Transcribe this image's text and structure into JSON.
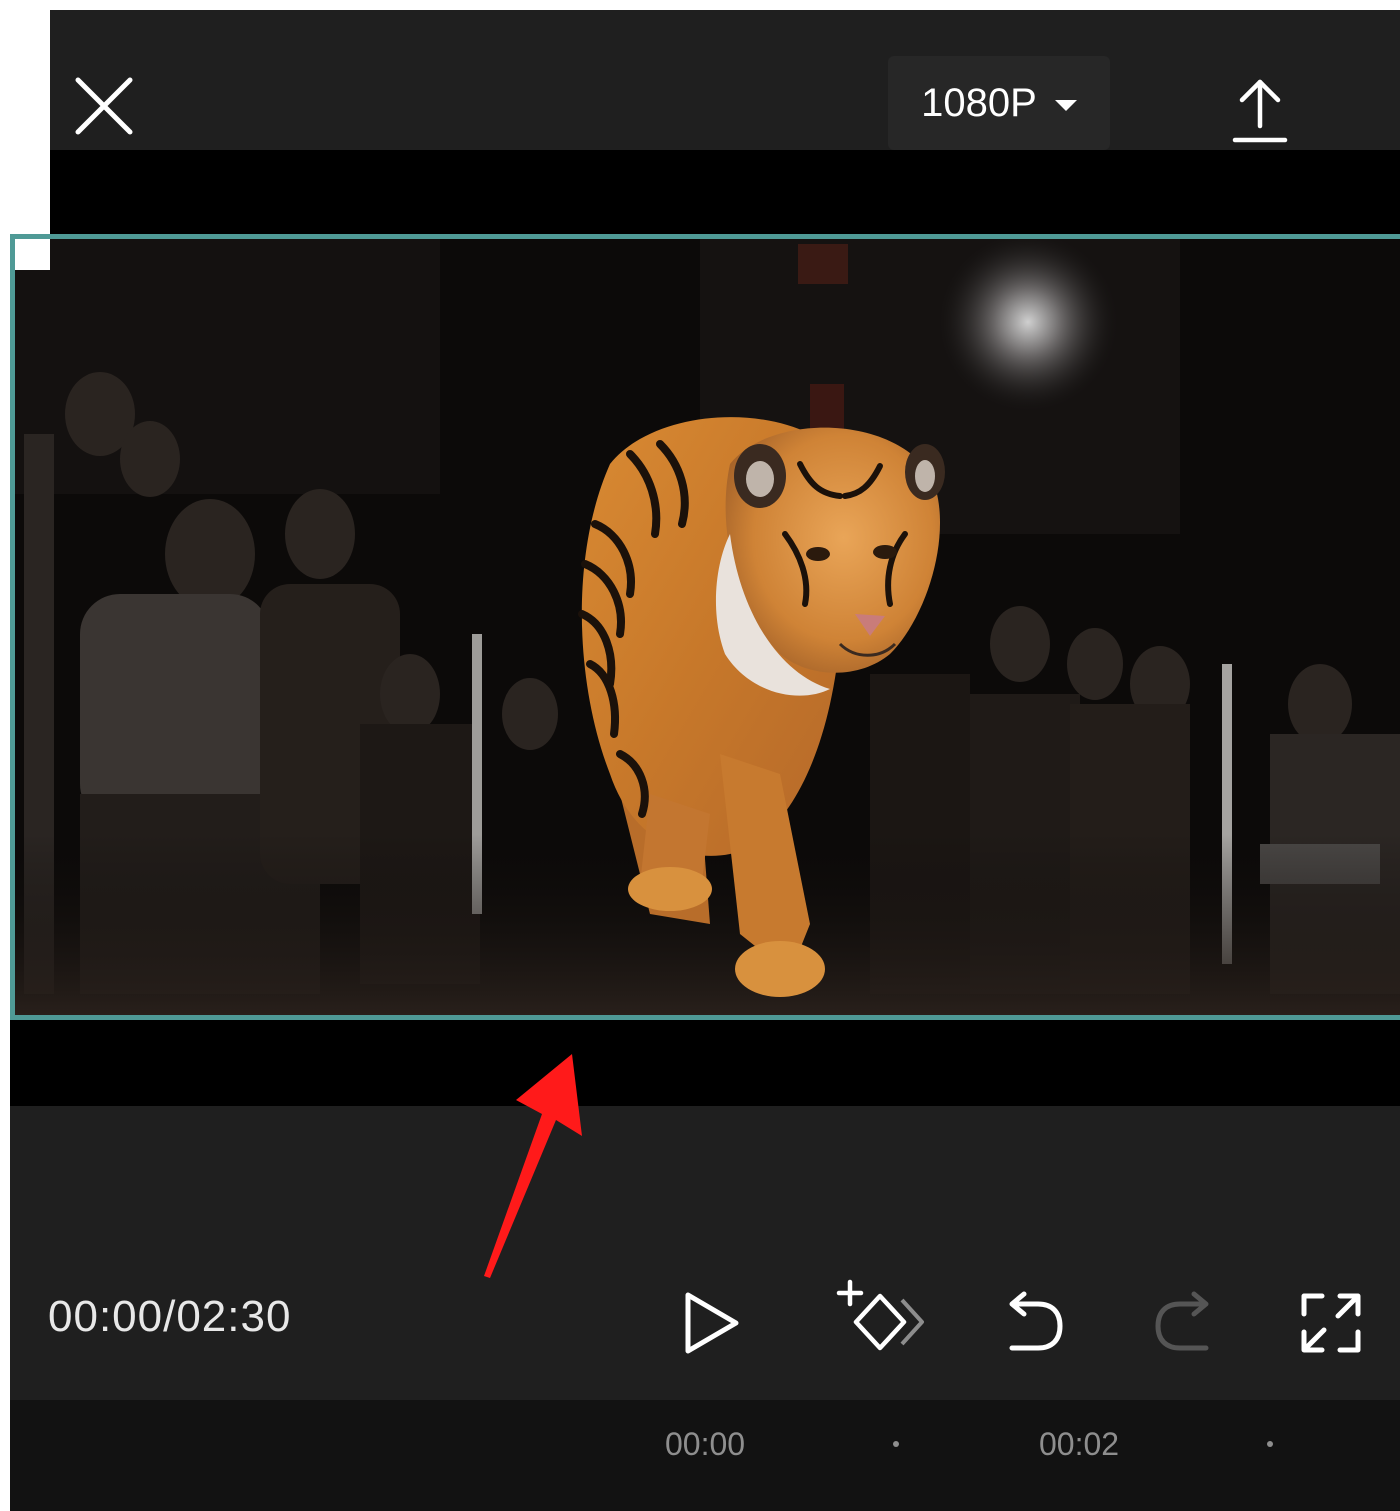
{
  "topbar": {
    "close_icon": "close-icon",
    "resolution_label": "1080P",
    "resolution_icon": "caret-down-icon",
    "export_icon": "upload-icon"
  },
  "preview": {
    "content": "tiger-video-frame",
    "selected_border_color": "#4f9a96"
  },
  "controls": {
    "timecode": "00:00/02:30",
    "play_icon": "play-icon",
    "keyframe_icon": "add-keyframe-icon",
    "undo_icon": "undo-icon",
    "redo_icon": "redo-icon",
    "fullscreen_icon": "fullscreen-icon"
  },
  "timeline": {
    "ticks": [
      "00:00",
      "00:02"
    ]
  },
  "annotation": {
    "arrow_color": "#ff1a1a"
  }
}
